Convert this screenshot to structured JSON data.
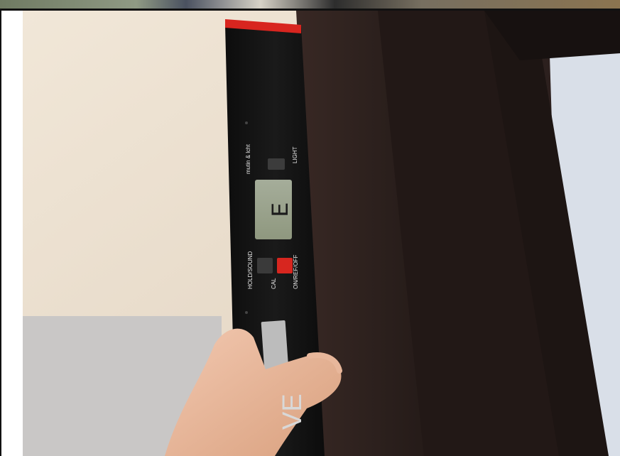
{
  "photo": {
    "level_buttons": {
      "mute_label": "mutin & lcht",
      "light_label": "LIGHT",
      "hold_label": "HOLD/SOUND",
      "cal_label": "CAL",
      "onoff_label": "ON/REF/OFF"
    },
    "display_text": "E",
    "brand_text": "VE"
  },
  "colors": {
    "wall": "#e7dccd",
    "door_frame": "#2b1f1d",
    "level_body": "#151515",
    "red_cap": "#d8251f",
    "lcd_screen": "#9aa38f",
    "on_button": "#d7261f"
  }
}
